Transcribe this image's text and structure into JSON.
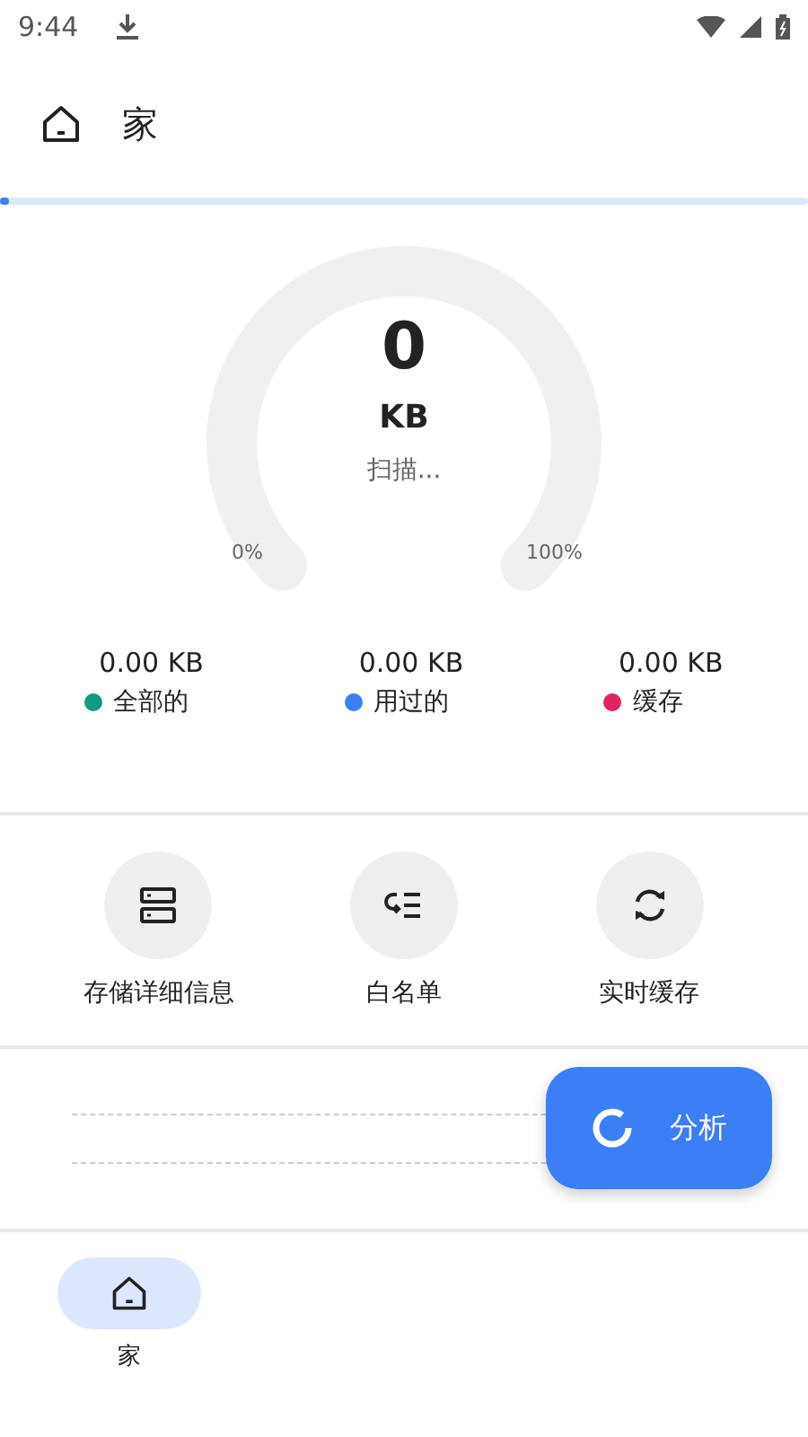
{
  "status_bar": {
    "time": "9:44"
  },
  "header": {
    "title": "家"
  },
  "scan_progress": {
    "level": 0.01
  },
  "gauge": {
    "value": "0",
    "unit": "KB",
    "status": "扫描...",
    "min_label": "0%",
    "max_label": "100%"
  },
  "stats": [
    {
      "value": "0.00 KB",
      "label": "全部的",
      "color": "#129a7f"
    },
    {
      "value": "0.00 KB",
      "label": "用过的",
      "color": "#3b7ef6"
    },
    {
      "value": "0.00 KB",
      "label": "缓存",
      "color": "#e0245e"
    }
  ],
  "actions": [
    {
      "kind": "storage",
      "label": "存储详细信息"
    },
    {
      "kind": "whitelist",
      "label": "白名单"
    },
    {
      "kind": "sync",
      "label": "实时缓存"
    }
  ],
  "analyze_button": {
    "label": "分析"
  },
  "bottom_nav": [
    {
      "label": "家",
      "selected": true
    }
  ]
}
